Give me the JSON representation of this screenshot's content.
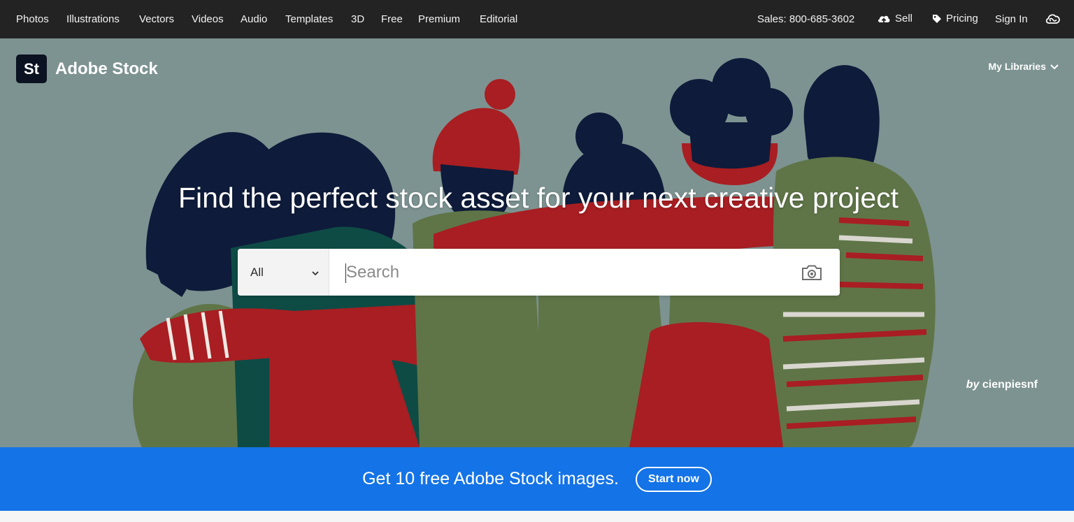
{
  "nav": {
    "items": [
      "Photos",
      "Illustrations",
      "Vectors",
      "Videos",
      "Audio",
      "Templates",
      "3D",
      "Free",
      "Premium",
      "Editorial"
    ],
    "sales": "Sales: 800-685-3602",
    "sell": "Sell",
    "pricing": "Pricing",
    "signin": "Sign In",
    "icons": {
      "sell": "cloud-upload-icon",
      "pricing": "price-tag-icon",
      "creative_cloud": "creative-cloud-icon"
    }
  },
  "brand": {
    "logo": "St",
    "name": "Adobe Stock"
  },
  "my_libraries": "My Libraries",
  "hero": {
    "headline": "Find the perfect stock asset for your next creative project",
    "credit_by": "by",
    "credit_name": "cienpiesnf",
    "background_color": "#7d9391"
  },
  "search": {
    "scope": "All",
    "placeholder": "Search",
    "value": ""
  },
  "promo": {
    "message": "Get 10 free Adobe Stock images.",
    "button": "Start now",
    "color": "#1473e6"
  }
}
